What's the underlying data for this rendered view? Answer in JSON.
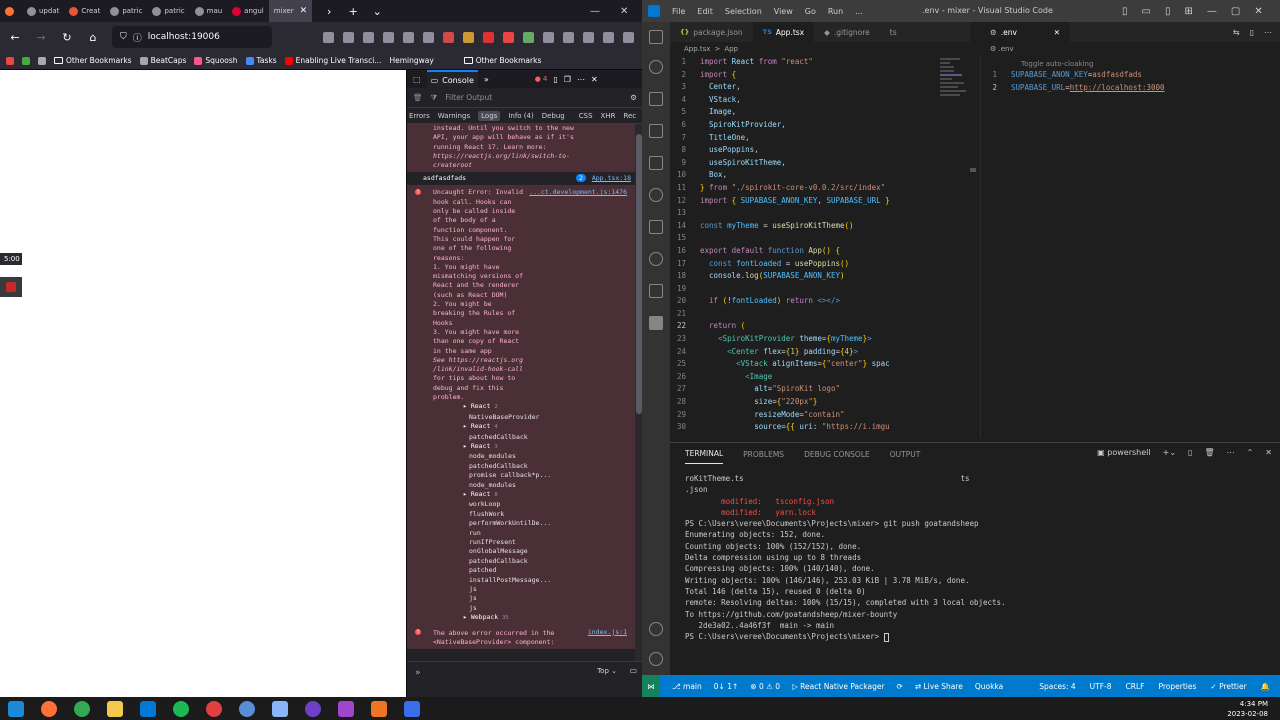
{
  "firefox": {
    "tabs": [
      {
        "label": "",
        "icon": "firefox-icon"
      },
      {
        "label": "updat",
        "icon": "github-icon"
      },
      {
        "label": "Creat",
        "icon": "react-icon"
      },
      {
        "label": "patric",
        "icon": "github-icon"
      },
      {
        "label": "patric",
        "icon": "github-icon"
      },
      {
        "label": "mau",
        "icon": "github-icon"
      },
      {
        "label": "angul",
        "icon": "angular-icon"
      },
      {
        "label": "mixer",
        "icon": "page-icon"
      }
    ],
    "url": "localhost:19006",
    "bookmarks": [
      "Other Bookmarks",
      "BeatCaps",
      "Squoosh",
      "Tasks",
      "Enabling Live Transci...",
      "Hemingway",
      "Other Bookmarks"
    ],
    "page": {
      "clock": "5:00"
    },
    "devtools": {
      "console_tab": "Console",
      "error_count": "4",
      "filter_placeholder": "Filter Output",
      "levels": [
        "Errors",
        "Warnings",
        "Logs",
        "Info (4)",
        "Debug",
        "CSS",
        "XHR",
        "Rec"
      ],
      "prev_error_tail": [
        "instead. Until you switch to the new",
        "API, your app will behave as if it's",
        "running React 17. Learn more:",
        "https://reactjs.org/link/switch-to-",
        "createroot"
      ],
      "log_line": {
        "text": "asdfasdfads",
        "count": "2",
        "src": "App.tsx:18"
      },
      "error": {
        "src": "...ct.development.js:1476",
        "lines": [
          "Uncaught Error: Invalid",
          "hook call. Hooks can",
          "only be called inside",
          "of the body of a",
          "function component.",
          "This could happen for",
          "one of the following",
          "reasons:",
          "1. You might have",
          "mismatching versions of",
          "React and the renderer",
          "(such as React DOM)",
          "2. You might be",
          "breaking the Rules of",
          "Hooks",
          "3. You might have more",
          "than one copy of React",
          "in the same app",
          "See https://reactjs.org",
          "/link/invalid-hook-call",
          "for tips about how to",
          "debug and fix this",
          "problem."
        ]
      },
      "stack": [
        {
          "name": "React",
          "count": "2",
          "group": true
        },
        {
          "name": "NativeBaseProvider",
          "group": false
        },
        {
          "name": "React",
          "count": "4",
          "group": true
        },
        {
          "name": "patchedCallback",
          "group": false
        },
        {
          "name": "React",
          "count": "3",
          "group": true
        },
        {
          "name": "node_modules",
          "group": false
        },
        {
          "name": "patchedCallback",
          "group": false
        },
        {
          "name": "promise callback*p...",
          "group": false
        },
        {
          "name": "node_modules",
          "group": false
        },
        {
          "name": "React",
          "count": "8",
          "group": true
        },
        {
          "name": "workLoop",
          "group": false
        },
        {
          "name": "flushWork",
          "group": false
        },
        {
          "name": "performWorkUntilDe...",
          "group": false
        },
        {
          "name": "run",
          "group": false
        },
        {
          "name": "runIfPresent",
          "group": false
        },
        {
          "name": "onGlobalMessage",
          "group": false
        },
        {
          "name": "patchedCallback",
          "group": false
        },
        {
          "name": "patched",
          "group": false
        },
        {
          "name": "installPostMessage...",
          "group": false
        },
        {
          "name": "js",
          "group": false
        },
        {
          "name": "js",
          "group": false
        },
        {
          "name": "js",
          "group": false
        },
        {
          "name": "Webpack",
          "count": "35",
          "group": true
        }
      ],
      "error2": {
        "lines": [
          "The above error occurred in the",
          "<NativeBaseProvider> component:"
        ],
        "src": "index.js:1"
      },
      "top_label": "Top"
    }
  },
  "vscode": {
    "menu": [
      "File",
      "Edit",
      "Selection",
      "View",
      "Go",
      "Run",
      "..."
    ],
    "window_title": ".env - mixer - Visual Studio Code",
    "left_tabs": [
      {
        "label": "package.json",
        "active": false,
        "lang": "{}"
      },
      {
        "label": "App.tsx",
        "active": true,
        "lang": "TS"
      },
      {
        "label": ".gitignore",
        "active": false,
        "lang": ""
      },
      {
        "label": "ts",
        "active": false,
        "lang": ""
      }
    ],
    "left_breadcrumb": [
      "App.tsx",
      ">",
      "App"
    ],
    "right_tab": ".env",
    "right_breadcrumb": ".env",
    "env_hint": "Toggle auto-cloaking",
    "env_lines": [
      {
        "n": "1",
        "key": "SUPABASE_ANON_KEY",
        "val": "asdfasdfads"
      },
      {
        "n": "2",
        "key": "SUPABASE_URL",
        "val": "http://localhost:3000"
      }
    ],
    "panel_tabs": [
      "TERMINAL",
      "PROBLEMS",
      "DEBUG CONSOLE",
      "OUTPUT"
    ],
    "shell": "powershell",
    "terminal_lines": [
      "roKitTheme.ts                                                ts",
      ".json",
      "        modified:   tsconfig.json",
      "        modified:   yarn.lock",
      "",
      "PS C:\\Users\\veree\\Documents\\Projects\\mixer> git push goatandsheep",
      "Enumerating objects: 152, done.",
      "Counting objects: 100% (152/152), done.",
      "Delta compression using up to 8 threads",
      "Compressing objects: 100% (140/140), done.",
      "Writing objects: 100% (146/146), 253.03 KiB | 3.78 MiB/s, done.",
      "Total 146 (delta 15), reused 0 (delta 0)",
      "remote: Resolving deltas: 100% (15/15), completed with 3 local objects.",
      "To https://github.com/goatandsheep/mixer-bounty",
      "   2de3a02..4a46f3f  main -> main",
      "PS C:\\Users\\veree\\Documents\\Projects\\mixer> "
    ],
    "status": {
      "branch": "main",
      "sync": "0↓ 1↑",
      "problems": "⊗ 0 ⚠ 0",
      "packager": "React Native Packager",
      "liveshare": "Live Share",
      "quokka": "Quokka",
      "spaces": "Spaces: 4",
      "encoding": "UTF-8",
      "eol": "CRLF",
      "properties": "Properties",
      "prettier": "Prettier"
    }
  },
  "taskbar": {
    "time": "4:34 PM",
    "date": "2023-02-08"
  },
  "colors": {
    "vs_status": "#007acc",
    "error_bg": "#4b2f36",
    "ff_bg": "#2b2a33"
  }
}
